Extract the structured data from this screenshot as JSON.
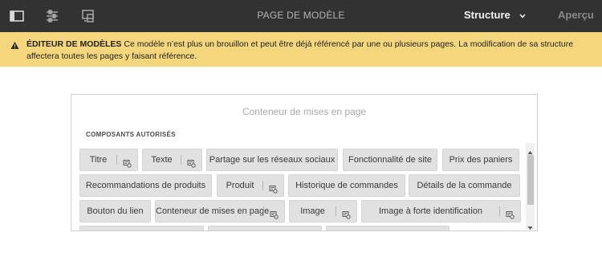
{
  "toolbar": {
    "page_title": "PAGE DE MODÈLE",
    "mode_label": "Structure",
    "preview_label": "Aperçu",
    "icons": [
      "side-panel-icon",
      "page-properties-icon",
      "emulator-icon",
      "chevron-down-icon"
    ]
  },
  "alert": {
    "icon": "warning-icon",
    "title": "ÉDITEUR DE MODÈLES",
    "message": " Ce modèle n’est plus un brouillon et peut être déjà référencé par une ou plusieurs pages. La modification de sa structure affectera toutes les pages y faisant référence."
  },
  "container": {
    "title": "Conteneur de mises en page",
    "section_label": "COMPOSANTS AUTORISÉS",
    "rows": [
      [
        {
          "label": "Titre",
          "config": true
        },
        {
          "label": "Texte",
          "config": true
        },
        {
          "label": "Partage sur les réseaux sociaux",
          "config": false
        },
        {
          "label": "Fonctionnalité de site",
          "config": false
        },
        {
          "label": "Prix des paniers",
          "config": false
        }
      ],
      [
        {
          "label": "Recommandations de produits",
          "config": false
        },
        {
          "label": "Produit",
          "config": true
        },
        {
          "label": "Historique de commandes",
          "config": false
        },
        {
          "label": "Détails de la commande",
          "config": false
        }
      ],
      [
        {
          "label": "Bouton du lien",
          "config": false
        },
        {
          "label": "Conteneur de mises en page",
          "config": true
        },
        {
          "label": "Image",
          "config": true
        },
        {
          "label": "Image à forte identification",
          "config": true
        }
      ]
    ]
  },
  "colors": {
    "toolbar_bg": "#323232",
    "alert_bg": "#f4d67d",
    "chip_bg": "#e1e1e1"
  }
}
